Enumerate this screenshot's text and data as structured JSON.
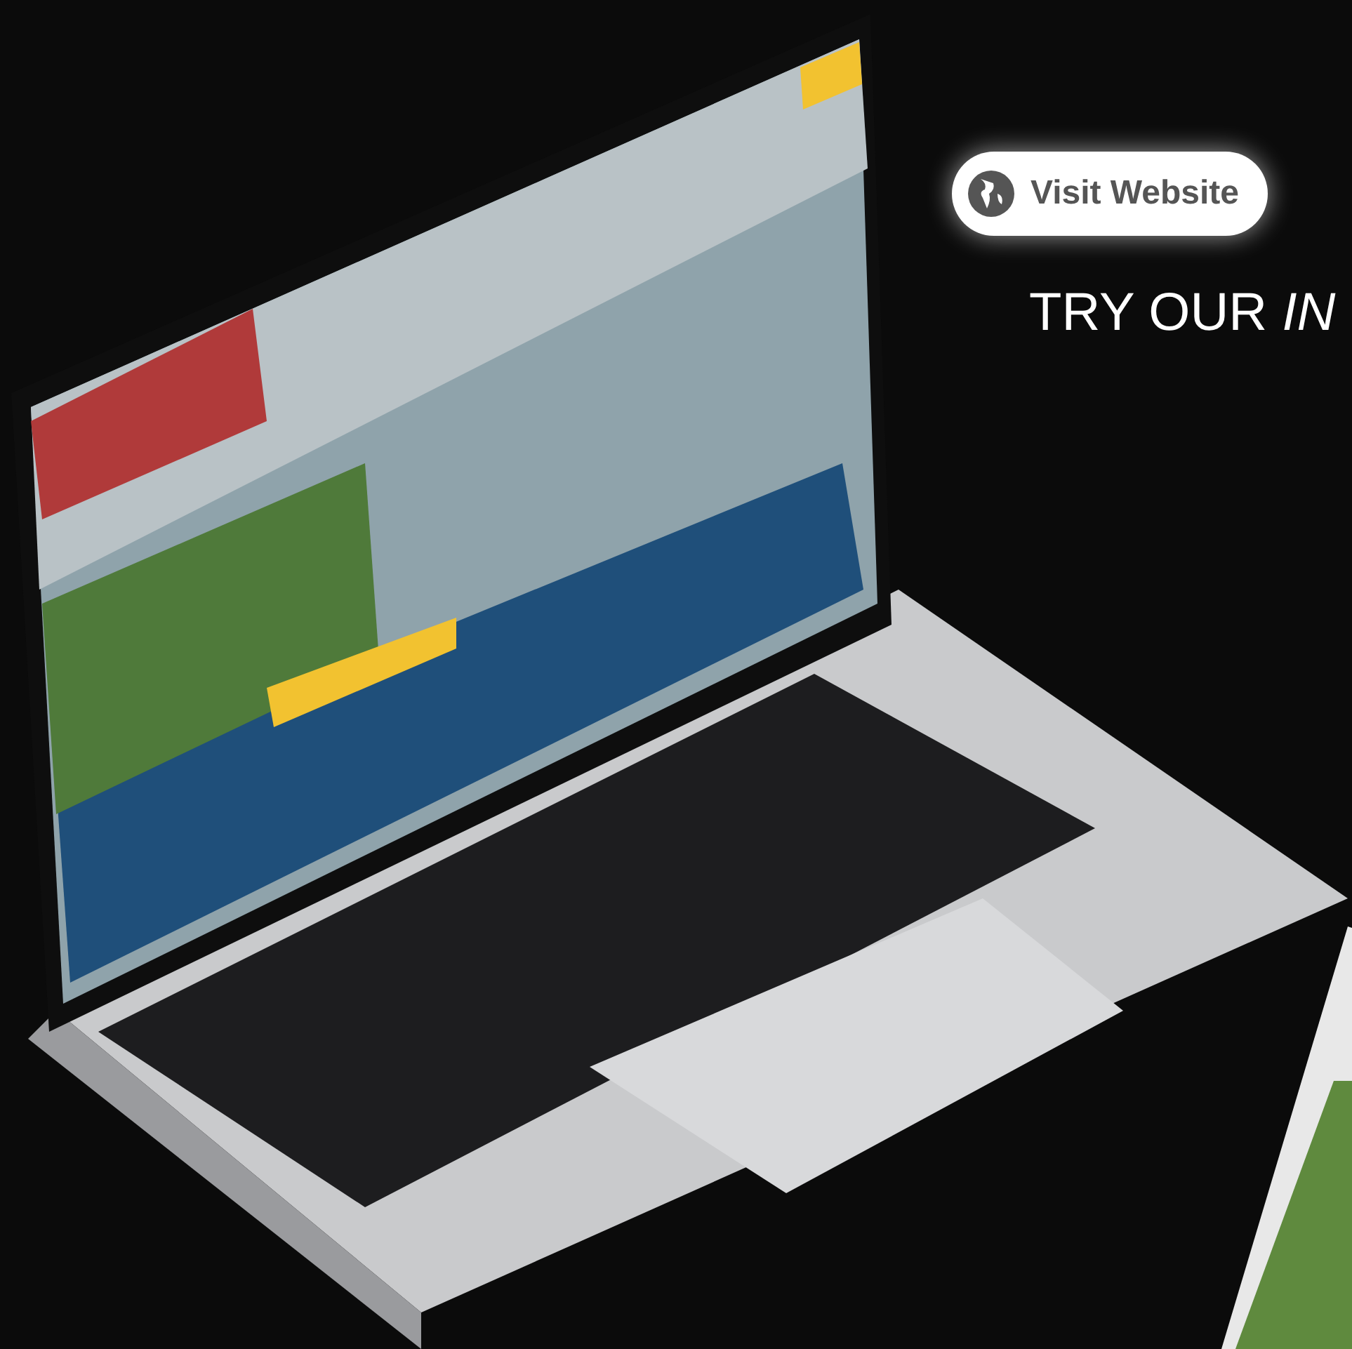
{
  "visit_button": {
    "label": "Visit Website"
  },
  "heading": "TRY OUR *IN*"
}
